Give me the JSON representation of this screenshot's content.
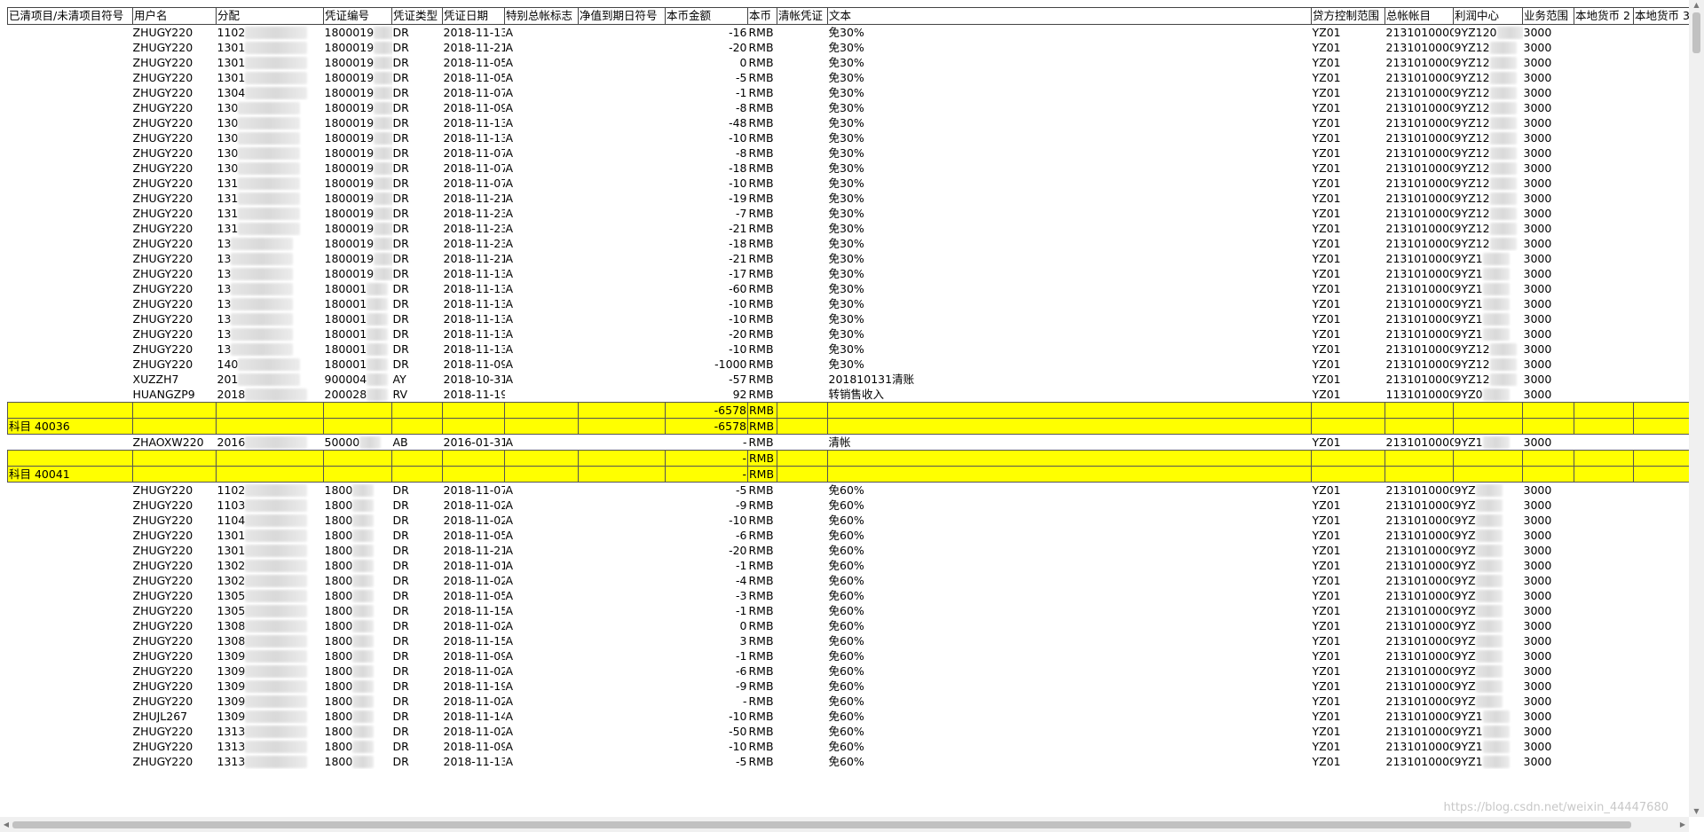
{
  "columns": [
    "已清项目/未清项目符号",
    "用户名",
    "分配",
    "凭证编号",
    "凭证类型",
    "凭证日期",
    "特别总帐标志",
    "净值到期日符号",
    "本币金额",
    "本币",
    "清帐凭证",
    "文本",
    "贷方控制范围",
    "总帐帐目",
    "利润中心",
    "业务范围",
    "本地货币 2",
    "本地货币 3"
  ],
  "rows": [
    {
      "type": "data",
      "user": "ZHUGY220",
      "assign": "1102",
      "doc": "1800019",
      "dtype": "DR",
      "date": "2018-11-13",
      "sym": "A",
      "amt": "-16",
      "cur": "RMB",
      "text": "免30%",
      "cca": "YZ01",
      "gl": "2131010000",
      "pc": "9YZ120",
      "ba": "3000"
    },
    {
      "type": "data",
      "user": "ZHUGY220",
      "assign": "1301",
      "doc": "1800019",
      "dtype": "DR",
      "date": "2018-11-21",
      "sym": "A",
      "amt": "-20",
      "cur": "RMB",
      "text": "免30%",
      "cca": "YZ01",
      "gl": "2131010000",
      "pc": "9YZ12",
      "ba": "3000"
    },
    {
      "type": "data",
      "user": "ZHUGY220",
      "assign": "1301",
      "doc": "1800019",
      "dtype": "DR",
      "date": "2018-11-05",
      "sym": "A",
      "amt": "0",
      "cur": "RMB",
      "text": "免30%",
      "cca": "YZ01",
      "gl": "2131010000",
      "pc": "9YZ12",
      "ba": "3000"
    },
    {
      "type": "data",
      "user": "ZHUGY220",
      "assign": "1301",
      "doc": "1800019",
      "dtype": "DR",
      "date": "2018-11-05",
      "sym": "A",
      "amt": "-5",
      "cur": "RMB",
      "text": "免30%",
      "cca": "YZ01",
      "gl": "2131010000",
      "pc": "9YZ12",
      "ba": "3000"
    },
    {
      "type": "data",
      "user": "ZHUGY220",
      "assign": "1304",
      "doc": "1800019",
      "dtype": "DR",
      "date": "2018-11-07",
      "sym": "A",
      "amt": "-1",
      "cur": "RMB",
      "text": "免30%",
      "cca": "YZ01",
      "gl": "2131010000",
      "pc": "9YZ12",
      "ba": "3000"
    },
    {
      "type": "data",
      "user": "ZHUGY220",
      "assign": "130",
      "doc": "1800019",
      "dtype": "DR",
      "date": "2018-11-09",
      "sym": "A",
      "amt": "-8",
      "cur": "RMB",
      "text": "免30%",
      "cca": "YZ01",
      "gl": "2131010000",
      "pc": "9YZ12",
      "ba": "3000"
    },
    {
      "type": "data",
      "user": "ZHUGY220",
      "assign": "130",
      "doc": "1800019",
      "dtype": "DR",
      "date": "2018-11-13",
      "sym": "A",
      "amt": "-48",
      "cur": "RMB",
      "text": "免30%",
      "cca": "YZ01",
      "gl": "2131010000",
      "pc": "9YZ12",
      "ba": "3000"
    },
    {
      "type": "data",
      "user": "ZHUGY220",
      "assign": "130",
      "doc": "1800019",
      "dtype": "DR",
      "date": "2018-11-13",
      "sym": "A",
      "amt": "-10",
      "cur": "RMB",
      "text": "免30%",
      "cca": "YZ01",
      "gl": "2131010000",
      "pc": "9YZ12",
      "ba": "3000"
    },
    {
      "type": "data",
      "user": "ZHUGY220",
      "assign": "130",
      "doc": "1800019",
      "dtype": "DR",
      "date": "2018-11-07",
      "sym": "A",
      "amt": "-8",
      "cur": "RMB",
      "text": "免30%",
      "cca": "YZ01",
      "gl": "2131010000",
      "pc": "9YZ12",
      "ba": "3000"
    },
    {
      "type": "data",
      "user": "ZHUGY220",
      "assign": "130",
      "doc": "1800019",
      "dtype": "DR",
      "date": "2018-11-07",
      "sym": "A",
      "amt": "-18",
      "cur": "RMB",
      "text": "免30%",
      "cca": "YZ01",
      "gl": "2131010000",
      "pc": "9YZ12",
      "ba": "3000"
    },
    {
      "type": "data",
      "user": "ZHUGY220",
      "assign": "131",
      "doc": "1800019",
      "dtype": "DR",
      "date": "2018-11-07",
      "sym": "A",
      "amt": "-10",
      "cur": "RMB",
      "text": "免30%",
      "cca": "YZ01",
      "gl": "2131010000",
      "pc": "9YZ12",
      "ba": "3000"
    },
    {
      "type": "data",
      "user": "ZHUGY220",
      "assign": "131",
      "doc": "1800019",
      "dtype": "DR",
      "date": "2018-11-21",
      "sym": "A",
      "amt": "-19",
      "cur": "RMB",
      "text": "免30%",
      "cca": "YZ01",
      "gl": "2131010000",
      "pc": "9YZ12",
      "ba": "3000"
    },
    {
      "type": "data",
      "user": "ZHUGY220",
      "assign": "131",
      "doc": "1800019",
      "dtype": "DR",
      "date": "2018-11-23",
      "sym": "A",
      "amt": "-7",
      "cur": "RMB",
      "text": "免30%",
      "cca": "YZ01",
      "gl": "2131010000",
      "pc": "9YZ12",
      "ba": "3000"
    },
    {
      "type": "data",
      "user": "ZHUGY220",
      "assign": "131",
      "doc": "1800019",
      "dtype": "DR",
      "date": "2018-11-23",
      "sym": "A",
      "amt": "-21",
      "cur": "RMB",
      "text": "免30%",
      "cca": "YZ01",
      "gl": "2131010000",
      "pc": "9YZ12",
      "ba": "3000"
    },
    {
      "type": "data",
      "user": "ZHUGY220",
      "assign": "13",
      "doc": "1800019",
      "dtype": "DR",
      "date": "2018-11-23",
      "sym": "A",
      "amt": "-18",
      "cur": "RMB",
      "text": "免30%",
      "cca": "YZ01",
      "gl": "2131010000",
      "pc": "9YZ12",
      "ba": "3000"
    },
    {
      "type": "data",
      "user": "ZHUGY220",
      "assign": "13",
      "doc": "1800019",
      "dtype": "DR",
      "date": "2018-11-21",
      "sym": "A",
      "amt": "-21",
      "cur": "RMB",
      "text": "免30%",
      "cca": "YZ01",
      "gl": "2131010000",
      "pc": "9YZ1",
      "ba": "3000"
    },
    {
      "type": "data",
      "user": "ZHUGY220",
      "assign": "13",
      "doc": "1800019",
      "dtype": "DR",
      "date": "2018-11-13",
      "sym": "A",
      "amt": "-17",
      "cur": "RMB",
      "text": "免30%",
      "cca": "YZ01",
      "gl": "2131010000",
      "pc": "9YZ1",
      "ba": "3000"
    },
    {
      "type": "data",
      "user": "ZHUGY220",
      "assign": "13",
      "doc": "180001",
      "dtype": "DR",
      "date": "2018-11-13",
      "sym": "A",
      "amt": "-60",
      "cur": "RMB",
      "text": "免30%",
      "cca": "YZ01",
      "gl": "2131010000",
      "pc": "9YZ1",
      "ba": "3000"
    },
    {
      "type": "data",
      "user": "ZHUGY220",
      "assign": "13",
      "doc": "180001",
      "dtype": "DR",
      "date": "2018-11-13",
      "sym": "A",
      "amt": "-10",
      "cur": "RMB",
      "text": "免30%",
      "cca": "YZ01",
      "gl": "2131010000",
      "pc": "9YZ1",
      "ba": "3000"
    },
    {
      "type": "data",
      "user": "ZHUGY220",
      "assign": "13",
      "doc": "180001",
      "dtype": "DR",
      "date": "2018-11-13",
      "sym": "A",
      "amt": "-10",
      "cur": "RMB",
      "text": "免30%",
      "cca": "YZ01",
      "gl": "2131010000",
      "pc": "9YZ1",
      "ba": "3000"
    },
    {
      "type": "data",
      "user": "ZHUGY220",
      "assign": "13",
      "doc": "180001",
      "dtype": "DR",
      "date": "2018-11-13",
      "sym": "A",
      "amt": "-20",
      "cur": "RMB",
      "text": "免30%",
      "cca": "YZ01",
      "gl": "2131010000",
      "pc": "9YZ1",
      "ba": "3000"
    },
    {
      "type": "data",
      "user": "ZHUGY220",
      "assign": "13",
      "doc": "180001",
      "dtype": "DR",
      "date": "2018-11-13",
      "sym": "A",
      "amt": "-10",
      "cur": "RMB",
      "text": "免30%",
      "cca": "YZ01",
      "gl": "2131010000",
      "pc": "9YZ12",
      "ba": "3000"
    },
    {
      "type": "data",
      "user": "ZHUGY220",
      "assign": "140",
      "doc": "180001",
      "dtype": "DR",
      "date": "2018-11-09",
      "sym": "A",
      "amt": "-1000",
      "cur": "RMB",
      "text": "免30%",
      "cca": "YZ01",
      "gl": "2131010000",
      "pc": "9YZ12",
      "ba": "3000"
    },
    {
      "type": "data",
      "user": "XUZZH7",
      "assign": "201",
      "doc": "900004",
      "dtype": "AY",
      "date": "2018-10-31",
      "sym": "A",
      "amt": "-57",
      "cur": "RMB",
      "text": "201810131清账",
      "cca": "YZ01",
      "gl": "2131010000",
      "pc": "9YZ12",
      "ba": "3000"
    },
    {
      "type": "data",
      "user": "HUANGZP9",
      "assign": "2018",
      "doc": "200028",
      "dtype": "RV",
      "date": "2018-11-19",
      "sym": "",
      "amt": "92",
      "cur": "RMB",
      "text": "转销售收入",
      "cca": "YZ01",
      "gl": "1131010000",
      "pc": "9YZ0",
      "ba": "3000"
    },
    {
      "type": "subtotal",
      "label": "",
      "amt": "-6578",
      "cur": "RMB"
    },
    {
      "type": "subtotal",
      "label": "科目 40036",
      "amt": "-6578",
      "cur": "RMB"
    },
    {
      "type": "data",
      "user": "ZHAOXW220",
      "assign": "2016",
      "doc": "50000",
      "dtype": "AB",
      "date": "2016-01-31",
      "sym": "A",
      "amt": "-",
      "cur": "RMB",
      "text": "清帐",
      "cca": "YZ01",
      "gl": "2131010000",
      "pc": "9YZ1",
      "ba": "3000"
    },
    {
      "type": "subtotal",
      "label": "",
      "amt": "-",
      "cur": "RMB"
    },
    {
      "type": "subtotal",
      "label": "科目 40041",
      "amt": "-",
      "cur": "RMB"
    },
    {
      "type": "data",
      "user": "ZHUGY220",
      "assign": "1102",
      "doc": "1800",
      "dtype": "DR",
      "date": "2018-11-07",
      "sym": "A",
      "amt": "-5",
      "cur": "RMB",
      "text": "免60%",
      "cca": "YZ01",
      "gl": "2131010000",
      "pc": "9YZ",
      "ba": "3000"
    },
    {
      "type": "data",
      "user": "ZHUGY220",
      "assign": "1103",
      "doc": "1800",
      "dtype": "DR",
      "date": "2018-11-02",
      "sym": "A",
      "amt": "-9",
      "cur": "RMB",
      "text": "免60%",
      "cca": "YZ01",
      "gl": "2131010000",
      "pc": "9YZ",
      "ba": "3000"
    },
    {
      "type": "data",
      "user": "ZHUGY220",
      "assign": "1104",
      "doc": "1800",
      "dtype": "DR",
      "date": "2018-11-02",
      "sym": "A",
      "amt": "-10",
      "cur": "RMB",
      "text": "免60%",
      "cca": "YZ01",
      "gl": "2131010000",
      "pc": "9YZ",
      "ba": "3000"
    },
    {
      "type": "data",
      "user": "ZHUGY220",
      "assign": "1301",
      "doc": "1800",
      "dtype": "DR",
      "date": "2018-11-05",
      "sym": "A",
      "amt": "-6",
      "cur": "RMB",
      "text": "免60%",
      "cca": "YZ01",
      "gl": "2131010000",
      "pc": "9YZ",
      "ba": "3000"
    },
    {
      "type": "data",
      "user": "ZHUGY220",
      "assign": "1301",
      "doc": "1800",
      "dtype": "DR",
      "date": "2018-11-21",
      "sym": "A",
      "amt": "-20",
      "cur": "RMB",
      "text": "免60%",
      "cca": "YZ01",
      "gl": "2131010000",
      "pc": "9YZ",
      "ba": "3000"
    },
    {
      "type": "data",
      "user": "ZHUGY220",
      "assign": "1302",
      "doc": "1800",
      "dtype": "DR",
      "date": "2018-11-01",
      "sym": "A",
      "amt": "-1",
      "cur": "RMB",
      "text": "免60%",
      "cca": "YZ01",
      "gl": "2131010000",
      "pc": "9YZ",
      "ba": "3000"
    },
    {
      "type": "data",
      "user": "ZHUGY220",
      "assign": "1302",
      "doc": "1800",
      "dtype": "DR",
      "date": "2018-11-02",
      "sym": "A",
      "amt": "-4",
      "cur": "RMB",
      "text": "免60%",
      "cca": "YZ01",
      "gl": "2131010000",
      "pc": "9YZ",
      "ba": "3000"
    },
    {
      "type": "data",
      "user": "ZHUGY220",
      "assign": "1305",
      "doc": "1800",
      "dtype": "DR",
      "date": "2018-11-05",
      "sym": "A",
      "amt": "-3",
      "cur": "RMB",
      "text": "免60%",
      "cca": "YZ01",
      "gl": "2131010000",
      "pc": "9YZ",
      "ba": "3000"
    },
    {
      "type": "data",
      "user": "ZHUGY220",
      "assign": "1305",
      "doc": "1800",
      "dtype": "DR",
      "date": "2018-11-15",
      "sym": "A",
      "amt": "-1",
      "cur": "RMB",
      "text": "免60%",
      "cca": "YZ01",
      "gl": "2131010000",
      "pc": "9YZ",
      "ba": "3000"
    },
    {
      "type": "data",
      "user": "ZHUGY220",
      "assign": "1308",
      "doc": "1800",
      "dtype": "DR",
      "date": "2018-11-02",
      "sym": "A",
      "amt": "0",
      "cur": "RMB",
      "text": "免60%",
      "cca": "YZ01",
      "gl": "2131010000",
      "pc": "9YZ",
      "ba": "3000"
    },
    {
      "type": "data",
      "user": "ZHUGY220",
      "assign": "1308",
      "doc": "1800",
      "dtype": "DR",
      "date": "2018-11-15",
      "sym": "A",
      "amt": "3",
      "cur": "RMB",
      "text": "免60%",
      "cca": "YZ01",
      "gl": "2131010000",
      "pc": "9YZ",
      "ba": "3000"
    },
    {
      "type": "data",
      "user": "ZHUGY220",
      "assign": "1309",
      "doc": "1800",
      "dtype": "DR",
      "date": "2018-11-09",
      "sym": "A",
      "amt": "-1",
      "cur": "RMB",
      "text": "免60%",
      "cca": "YZ01",
      "gl": "2131010000",
      "pc": "9YZ",
      "ba": "3000"
    },
    {
      "type": "data",
      "user": "ZHUGY220",
      "assign": "1309",
      "doc": "1800",
      "dtype": "DR",
      "date": "2018-11-02",
      "sym": "A",
      "amt": "-6",
      "cur": "RMB",
      "text": "免60%",
      "cca": "YZ01",
      "gl": "2131010000",
      "pc": "9YZ",
      "ba": "3000"
    },
    {
      "type": "data",
      "user": "ZHUGY220",
      "assign": "1309",
      "doc": "1800",
      "dtype": "DR",
      "date": "2018-11-19",
      "sym": "A",
      "amt": "-9",
      "cur": "RMB",
      "text": "免60%",
      "cca": "YZ01",
      "gl": "2131010000",
      "pc": "9YZ",
      "ba": "3000"
    },
    {
      "type": "data",
      "user": "ZHUGY220",
      "assign": "1309",
      "doc": "1800",
      "dtype": "DR",
      "date": "2018-11-02",
      "sym": "A",
      "amt": "-",
      "cur": "RMB",
      "text": "免60%",
      "cca": "YZ01",
      "gl": "2131010000",
      "pc": "9YZ",
      "ba": "3000"
    },
    {
      "type": "data",
      "user": "ZHUJL267",
      "assign": "1309",
      "doc": "1800",
      "dtype": "DR",
      "date": "2018-11-14",
      "sym": "A",
      "amt": "-10",
      "cur": "RMB",
      "text": "免60%",
      "cca": "YZ01",
      "gl": "2131010000",
      "pc": "9YZ1",
      "ba": "3000"
    },
    {
      "type": "data",
      "user": "ZHUGY220",
      "assign": "1313",
      "doc": "1800",
      "dtype": "DR",
      "date": "2018-11-02",
      "sym": "A",
      "amt": "-50",
      "cur": "RMB",
      "text": "免60%",
      "cca": "YZ01",
      "gl": "2131010000",
      "pc": "9YZ1",
      "ba": "3000"
    },
    {
      "type": "data",
      "user": "ZHUGY220",
      "assign": "1313",
      "doc": "1800",
      "dtype": "DR",
      "date": "2018-11-09",
      "sym": "A",
      "amt": "-10",
      "cur": "RMB",
      "text": "免60%",
      "cca": "YZ01",
      "gl": "2131010000",
      "pc": "9YZ1",
      "ba": "3000"
    },
    {
      "type": "data",
      "user": "ZHUGY220",
      "assign": "1313",
      "doc": "1800",
      "dtype": "DR",
      "date": "2018-11-13",
      "sym": "A",
      "amt": "-5",
      "cur": "RMB",
      "text": "免60%",
      "cca": "YZ01",
      "gl": "2131010000",
      "pc": "9YZ1",
      "ba": "3000"
    }
  ],
  "watermark": "https://blog.csdn.net/weixin_44447680",
  "colors": {
    "subtotal_bg": "#ffff00",
    "scrollbar_bg": "#f0f0f0",
    "scroll_thumb": "#c1c1c1"
  }
}
